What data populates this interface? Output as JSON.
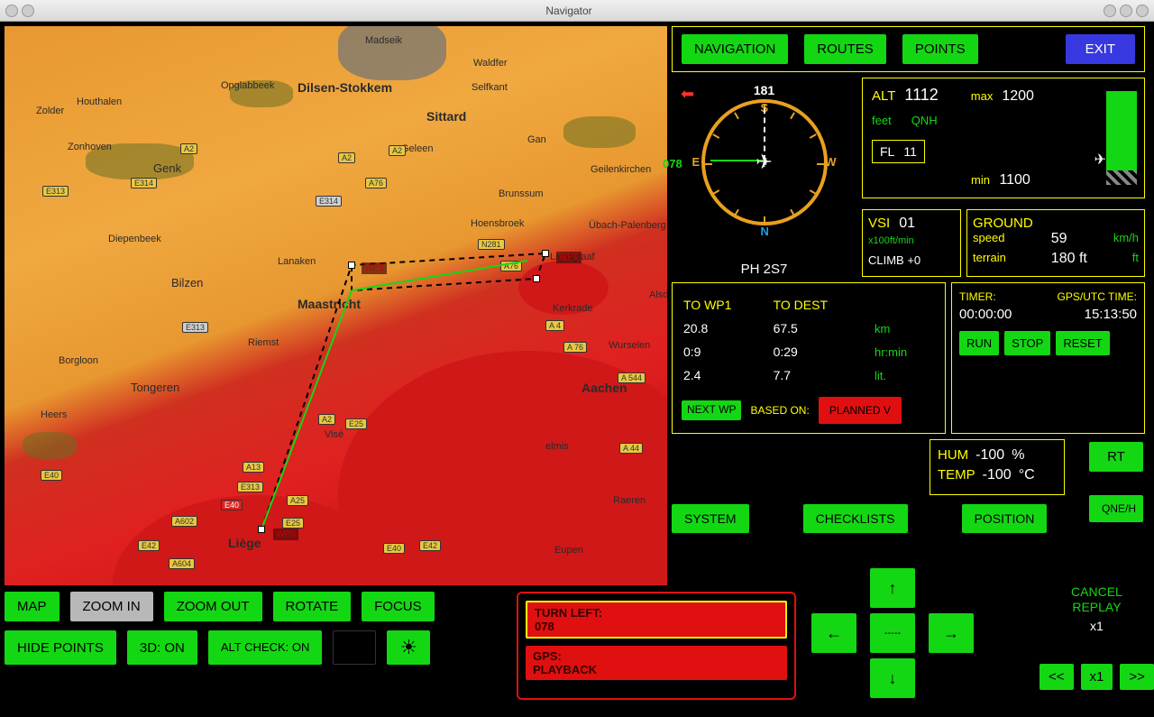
{
  "window": {
    "title": "Navigator"
  },
  "topbar": {
    "navigation": "NAVIGATION",
    "routes": "ROUTES",
    "points": "POINTS",
    "exit": "EXIT"
  },
  "compass": {
    "heading": "181",
    "course": "078",
    "n": "N",
    "s": "S",
    "e": "E",
    "w": "W"
  },
  "aircraft_id": "PH 2S7",
  "altitude": {
    "label": "ALT",
    "value": "1112",
    "max_label": "max",
    "max": "1200",
    "min_label": "min",
    "min": "1100",
    "unit": "feet",
    "qnh": "QNH",
    "fl_label": "FL",
    "fl": "11"
  },
  "vsi": {
    "label": "VSI",
    "value": "01",
    "unit": "x100ft/min",
    "climb": "CLIMB +0"
  },
  "ground": {
    "label": "GROUND",
    "speed_label": "speed",
    "speed": "59",
    "speed_unit": "km/h",
    "terrain_label": "terrain",
    "terrain": "180 ft",
    "terrain_unit": "ft"
  },
  "wp": {
    "to_wp1": "TO WP1",
    "to_dest": "TO DEST",
    "dist_wp1": "20.8",
    "dist_dest": "67.5",
    "dist_unit": "km",
    "time_wp1": "0:9",
    "time_dest": "0:29",
    "time_unit": "hr:min",
    "fuel_wp1": "2.4",
    "fuel_dest": "7.7",
    "fuel_unit": "lit.",
    "next_wp": "NEXT WP",
    "based_on": "BASED ON:",
    "planned_v": "PLANNED V"
  },
  "timer": {
    "timer_label": "TIMER:",
    "gps_label": "GPS/UTC TIME:",
    "timer_value": "00:00:00",
    "gps_value": "15:13:50",
    "run": "RUN",
    "stop": "STOP",
    "reset": "RESET"
  },
  "env": {
    "hum_label": "HUM",
    "hum": "-100",
    "hum_unit": "%",
    "temp_label": "TEMP",
    "temp": "-100",
    "temp_unit": "°C"
  },
  "rt": "RT",
  "qneh": "QNE/H",
  "system_row": {
    "system": "SYSTEM",
    "checklists": "CHECKLISTS",
    "position": "POSITION"
  },
  "bottom": {
    "map": "MAP",
    "zoom_in": "ZOOM IN",
    "zoom_out": "ZOOM OUT",
    "rotate": "ROTATE",
    "focus": "FOCUS",
    "hide_points": "HIDE POINTS",
    "mode_3d": "3D: ON",
    "alt_check": "ALT CHECK: ON"
  },
  "alerts": {
    "turn_left_1": "TURN LEFT:",
    "turn_left_2": "078",
    "gps_1": "GPS:",
    "gps_2": "PLAYBACK"
  },
  "dpad": {
    "center": "-----"
  },
  "replay": {
    "cancel": "CANCEL",
    "replay": "REPLAY",
    "speed": "x1",
    "back": "<<",
    "rate": "x1",
    "fwd": ">>"
  },
  "map_labels": {
    "dilsen": "Dilsen-Stokkem",
    "opglabbeek": "Opglabbeek",
    "houthalen": "Houthalen",
    "zolder": "Zolder",
    "zonhoven": "Zonhoven",
    "genk": "Genk",
    "diepenbeek": "Diepenbeek",
    "bilzen": "Bilzen",
    "borgloon": "Borgloon",
    "tongeren": "Tongeren",
    "heers": "Heers",
    "riemst": "Riemst",
    "lanaken": "Lanaken",
    "maastricht": "Maastricht",
    "vise": "Visé",
    "liege": "Liège",
    "sittard": "Sittard",
    "geleen": "Geleen",
    "selfkant": "Selfkant",
    "gan": "Gan",
    "geilenkirchen": "Geilenkirchen",
    "brunssum": "Brunssum",
    "hoensbroek": "Hoensbroek",
    "ubach": "Übach-Palenberg",
    "landgraaf": "Landgraaf",
    "kerkrade": "Kerkrade",
    "als": "Alsd",
    "wurselen": "Wurselen",
    "aachen": "Aachen",
    "elmis": "elmis",
    "raeren": "Raeren",
    "eupen": "Eupen",
    "waldfer": "Waldfer",
    "madseik": "Madseik"
  }
}
